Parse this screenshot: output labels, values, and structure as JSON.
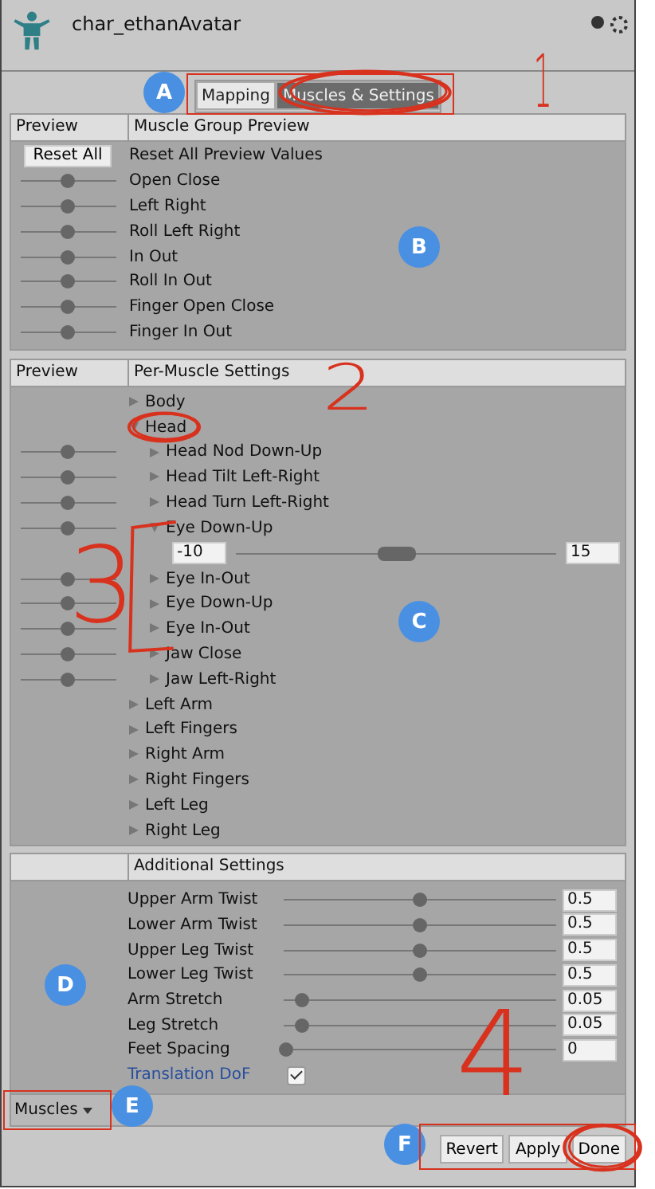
{
  "header": {
    "title": "char_ethanAvatar"
  },
  "tabs": [
    {
      "label": "Mapping",
      "selected": false
    },
    {
      "label": "Muscles & Settings",
      "selected": true
    }
  ],
  "muscle_group_preview": {
    "columns": [
      "Preview",
      "Muscle Group Preview"
    ],
    "reset_button": "Reset All",
    "reset_label": "Reset All Preview Values",
    "rows": [
      {
        "label": "Open Close",
        "level": 0.5
      },
      {
        "label": "Left Right",
        "level": 0.5
      },
      {
        "label": "Roll Left Right",
        "level": 0.5
      },
      {
        "label": "In Out",
        "level": 0.5
      },
      {
        "label": "Roll In Out",
        "level": 0.5
      },
      {
        "label": "Finger Open Close",
        "level": 0.5
      },
      {
        "label": "Finger In Out",
        "level": 0.5
      }
    ]
  },
  "per_muscle_settings": {
    "columns": [
      "Preview",
      "Per-Muscle Settings"
    ],
    "tree": [
      {
        "label": "Body",
        "expanded": false
      },
      {
        "label": "Head",
        "expanded": true,
        "children": [
          {
            "label": "Head Nod Down-Up",
            "expanded": false,
            "level": 0.5
          },
          {
            "label": "Head Tilt Left-Right",
            "expanded": false,
            "level": 0.5
          },
          {
            "label": "Head Turn Left-Right",
            "expanded": false,
            "level": 0.5
          },
          {
            "label": "Eye Down-Up",
            "expanded": true,
            "level": 0.5,
            "range": {
              "min": "-10",
              "max": "15",
              "level": 0.5
            }
          },
          {
            "label": "Eye In-Out",
            "expanded": false,
            "level": 0.5
          },
          {
            "label": "Eye Down-Up",
            "expanded": false,
            "level": 0.5
          },
          {
            "label": "Eye In-Out",
            "expanded": false,
            "level": 0.5
          },
          {
            "label": "Jaw Close",
            "expanded": false,
            "level": 0.5
          },
          {
            "label": "Jaw Left-Right",
            "expanded": false,
            "level": 0.5
          }
        ]
      },
      {
        "label": "Left Arm",
        "expanded": false
      },
      {
        "label": "Left Fingers",
        "expanded": false
      },
      {
        "label": "Right Arm",
        "expanded": false
      },
      {
        "label": "Right Fingers",
        "expanded": false
      },
      {
        "label": "Left Leg",
        "expanded": false
      },
      {
        "label": "Right Leg",
        "expanded": false
      }
    ]
  },
  "additional_settings": {
    "title": "Additional Settings",
    "rows": [
      {
        "kind": "slider",
        "label": "Upper Arm Twist",
        "level": 0.5,
        "value": "0.5"
      },
      {
        "kind": "slider",
        "label": "Lower Arm Twist",
        "level": 0.5,
        "value": "0.5"
      },
      {
        "kind": "slider",
        "label": "Upper Leg Twist",
        "level": 0.5,
        "value": "0.5"
      },
      {
        "kind": "slider",
        "label": "Lower Leg Twist",
        "level": 0.5,
        "value": "0.5"
      },
      {
        "kind": "slider",
        "label": "Arm Stretch",
        "level": 0.07,
        "value": "0.05"
      },
      {
        "kind": "slider",
        "label": "Leg Stretch",
        "level": 0.07,
        "value": "0.05"
      },
      {
        "kind": "slider",
        "label": "Feet Spacing",
        "level": 0.01,
        "value": "0"
      },
      {
        "kind": "checkbox",
        "label": "Translation DoF",
        "checked": true
      }
    ]
  },
  "footer": {
    "dropdown": "Muscles",
    "buttons": [
      "Revert",
      "Apply",
      "Done"
    ]
  },
  "annotations": {
    "callouts": [
      "A",
      "B",
      "C",
      "D",
      "E",
      "F"
    ],
    "numbers": [
      "1",
      "2",
      "3",
      "4"
    ]
  }
}
